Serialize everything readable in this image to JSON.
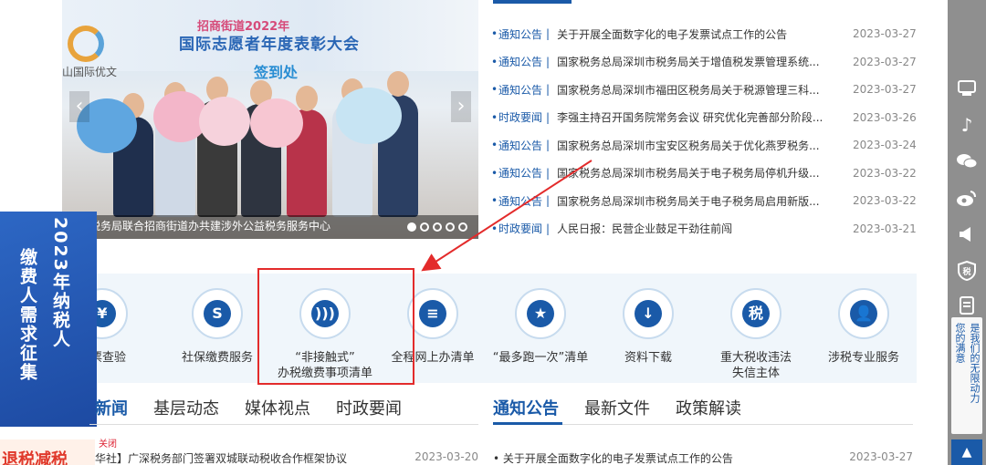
{
  "banner": {
    "subtitle": "招商街道2022年",
    "title": "国际志愿者年度表彰大会",
    "sign_text": "签到处",
    "side_text": "山国际优文",
    "caption": "税务局联合招商街道办共建涉外公益税务服务中心",
    "slide_count": 5
  },
  "news": {
    "items": [
      {
        "cat": "通知公告",
        "title": "关于开展全面数字化的电子发票试点工作的公告",
        "date": "2023-03-27"
      },
      {
        "cat": "通知公告",
        "title": "国家税务总局深圳市税务局关于增值税发票管理系统...",
        "date": "2023-03-27"
      },
      {
        "cat": "通知公告",
        "title": "国家税务总局深圳市福田区税务局关于税源管理三科...",
        "date": "2023-03-27"
      },
      {
        "cat": "时政要闻",
        "title": "李强主持召开国务院常务会议 研究优化完善部分阶段...",
        "date": "2023-03-26"
      },
      {
        "cat": "通知公告",
        "title": "国家税务总局深圳市宝安区税务局关于优化燕罗税务...",
        "date": "2023-03-24"
      },
      {
        "cat": "通知公告",
        "title": "国家税务总局深圳市税务局关于电子税务局停机升级...",
        "date": "2023-03-22"
      },
      {
        "cat": "通知公告",
        "title": "国家税务总局深圳市税务局关于电子税务局启用新版...",
        "date": "2023-03-22"
      },
      {
        "cat": "时政要闻",
        "title": "人民日报：民营企业鼓足干劲往前闯",
        "date": "2023-03-21"
      }
    ]
  },
  "services": [
    {
      "icon": "¥",
      "label": "发票查验",
      "label2": ""
    },
    {
      "icon": "S",
      "label": "社保缴费服务",
      "label2": ""
    },
    {
      "icon": ")))",
      "label": "“非接触式”",
      "label2": "办税缴费事项清单"
    },
    {
      "icon": "≡",
      "label": "全程网上办清单",
      "label2": ""
    },
    {
      "icon": "★",
      "label": "“最多跑一次”清单",
      "label2": ""
    },
    {
      "icon": "↓",
      "label": "资料下载",
      "label2": ""
    },
    {
      "icon": "税",
      "label": "重大税收违法",
      "label2": "失信主体"
    },
    {
      "icon": "👤",
      "label": "涉税专业服务",
      "label2": ""
    }
  ],
  "float_banner": {
    "col1": "2023年纳税人",
    "col2": "缴费人需求征集"
  },
  "tabs_left": [
    "新闻",
    "基层动态",
    "媒体视点",
    "时政要闻"
  ],
  "tabs_right": [
    "通知公告",
    "最新文件",
    "政策解读"
  ],
  "bottom_left": {
    "close": "关闭",
    "title": "华社】广深税务部门签署双城联动税收合作框架协议",
    "date": "2023-03-20",
    "promo": "退税减税"
  },
  "bottom_right": {
    "title": "• 关于开展全面数字化的电子发票试点工作的公告",
    "date": "2023-03-27"
  },
  "sidebar": {
    "card_col1": "是我们的无限动力",
    "card_col2": "您的满意"
  },
  "colors": {
    "accent": "#1a5aa8",
    "highlight": "#e32b2b",
    "sidebar": "#8f8f8f"
  }
}
